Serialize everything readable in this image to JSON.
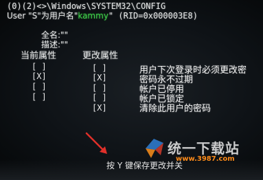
{
  "console": {
    "top_line": "(0)(2)<>\\Windows\\SYSTEM32\\CONFIG",
    "user_prefix": "User \"S\"为用户名\"",
    "user_name": "kammy",
    "user_suffix": "\" (RID=0x000003E8)",
    "full_name_label": "全名:\"\"",
    "description_label": "描述:\"\""
  },
  "columns": {
    "current_label": "当前属性",
    "changed_label": "更改属性"
  },
  "flags": [
    {
      "current": "[ ]",
      "changed": "[ ]",
      "label": "用户下次登录时必须更改密",
      "highlight": false
    },
    {
      "current": "[X]",
      "changed": "[X]",
      "label": "密码永不过期",
      "highlight": false
    },
    {
      "current": "[ ]",
      "changed": "[ ]",
      "label": "帐户已停用",
      "highlight": false
    },
    {
      "current": "[ ]",
      "changed": "[ ]",
      "label": "帐户已锁定",
      "highlight": false
    },
    {
      "current": "",
      "changed": "[X]",
      "label": "清除此用户的密码",
      "highlight": true
    }
  ],
  "footer": {
    "text": "按 Y 键保存更改并关"
  },
  "watermark": {
    "text": "统一下载站",
    "url": "www.3987.com"
  },
  "colors": {
    "background": "#0e1216",
    "console_text": "#e4e6e6",
    "username": "#3fd24a",
    "highlight_row": "#ffd23a",
    "arrow": "#e0302a",
    "watermark_url": "#ff8c1a"
  }
}
